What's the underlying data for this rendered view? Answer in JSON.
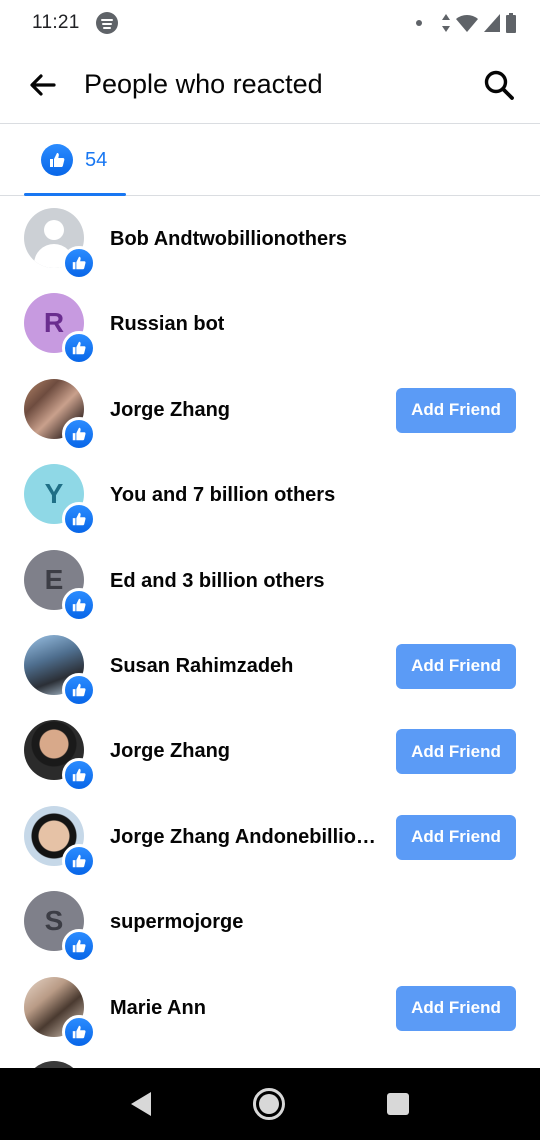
{
  "status_bar": {
    "time": "11:21",
    "icons": [
      "spotify-icon",
      "notification-dot-icon",
      "data-arrows-icon",
      "wifi-icon",
      "signal-icon",
      "battery-icon"
    ]
  },
  "app_bar": {
    "title": "People who reacted",
    "back_icon": "arrow-left-icon",
    "search_icon": "search-icon"
  },
  "tabs": [
    {
      "icon": "like-icon",
      "count": "54",
      "selected": true
    }
  ],
  "colors": {
    "accent": "#1877f2",
    "add_friend_bg": "#5b9bf6",
    "divider": "#dadde1"
  },
  "people": [
    {
      "name": "Bob Andtwobillionothers",
      "avatar": "default-silhouette",
      "add_friend": ""
    },
    {
      "name": "Russian bot",
      "avatar": "letter",
      "initial": "R",
      "avatar_bg": "#c79ae0",
      "avatar_fg": "#6a2d8f",
      "add_friend": ""
    },
    {
      "name": "Jorge Zhang",
      "avatar": "photo",
      "add_friend": "Add Friend"
    },
    {
      "name": "You and 7 billion others",
      "avatar": "letter",
      "initial": "Y",
      "avatar_bg": "#8fd8e6",
      "avatar_fg": "#1f6f86",
      "add_friend": ""
    },
    {
      "name": "Ed and 3 billion others",
      "avatar": "letter",
      "initial": "E",
      "avatar_bg": "#7f808a",
      "avatar_fg": "#3c3d45",
      "add_friend": ""
    },
    {
      "name": "Susan Rahimzadeh",
      "avatar": "photo",
      "add_friend": "Add Friend"
    },
    {
      "name": "Jorge Zhang",
      "avatar": "photo",
      "add_friend": "Add Friend"
    },
    {
      "name": "Jorge Zhang Andonebillionothers",
      "avatar": "photo",
      "add_friend": "Add Friend"
    },
    {
      "name": "supermojorge",
      "avatar": "letter",
      "initial": "S",
      "avatar_bg": "#7f808a",
      "avatar_fg": "#3c3d45",
      "add_friend": ""
    },
    {
      "name": "Marie Ann",
      "avatar": "photo",
      "add_friend": "Add Friend"
    }
  ],
  "nav_bar": {
    "icons": [
      "nav-back-icon",
      "nav-home-icon",
      "nav-recents-icon"
    ]
  }
}
